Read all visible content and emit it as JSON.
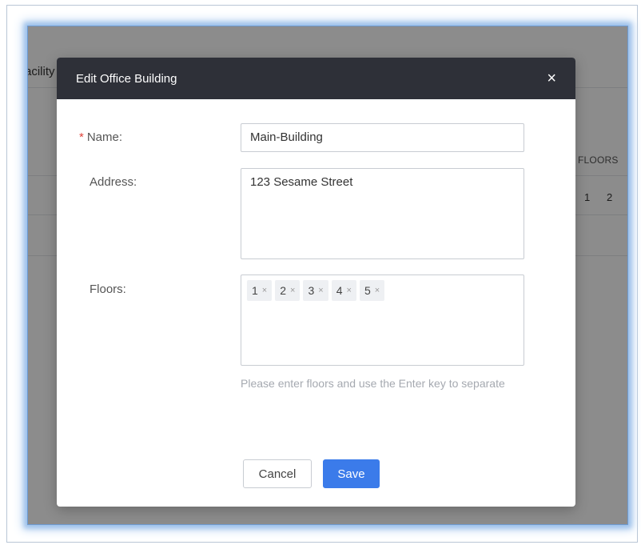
{
  "background": {
    "tab_fragment": "acility",
    "column_header": "FLOORS",
    "row_cells": [
      "1",
      "2"
    ]
  },
  "modal": {
    "title": "Edit Office Building",
    "close_glyph": "×",
    "name": {
      "required_mark": "*",
      "label": "Name:",
      "value": "Main-Building"
    },
    "address": {
      "label": "Address:",
      "value": "123 Sesame Street"
    },
    "floors": {
      "label": "Floors:",
      "tags": [
        "1",
        "2",
        "3",
        "4",
        "5"
      ],
      "remove_glyph": "×",
      "hint": "Please enter floors and use the Enter key to separate"
    },
    "buttons": {
      "cancel": "Cancel",
      "save": "Save"
    }
  },
  "colors": {
    "header_bg": "#2e3038",
    "primary": "#3b7bea",
    "required": "#e0423a"
  }
}
